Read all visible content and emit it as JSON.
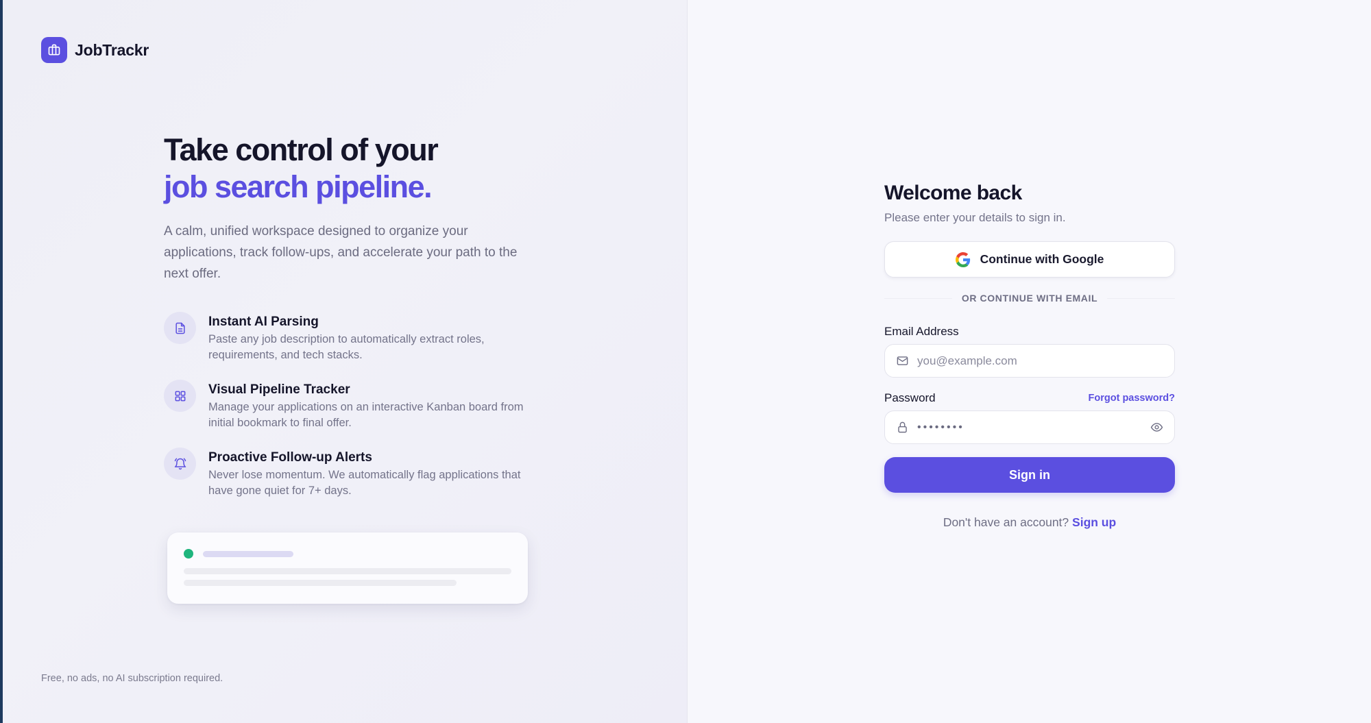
{
  "brand": {
    "name": "JobTrackr",
    "icon": "briefcase-icon"
  },
  "hero": {
    "title_line1": "Take control of your",
    "title_line2": "job search pipeline.",
    "description": "A calm, unified workspace designed to organize your applications, track follow-ups, and accelerate your path to the next offer."
  },
  "features": [
    {
      "icon": "document-icon",
      "title": "Instant AI Parsing",
      "desc": "Paste any job description to automatically extract roles, requirements, and tech stacks."
    },
    {
      "icon": "grid-icon",
      "title": "Visual Pipeline Tracker",
      "desc": "Manage your applications on an interactive Kanban board from initial bookmark to final offer."
    },
    {
      "icon": "bell-icon",
      "title": "Proactive Follow-up Alerts",
      "desc": "Never lose momentum. We automatically flag applications that have gone quiet for 7+ days."
    }
  ],
  "footnote": "Free, no ads, no AI subscription required.",
  "form": {
    "title": "Welcome back",
    "subtitle": "Please enter your details to sign in.",
    "google_label": "Continue with Google",
    "divider": "OR CONTINUE WITH EMAIL",
    "email_label": "Email Address",
    "email_placeholder": "you@example.com",
    "password_label": "Password",
    "forgot_label": "Forgot password?",
    "password_mask": "••••••••",
    "signin_label": "Sign in",
    "signup_prompt": "Don't have an account?",
    "signup_label": "Sign up"
  },
  "colors": {
    "accent": "#5B4FE0",
    "status_dot": "#1FB57D",
    "text": "#15152A"
  }
}
